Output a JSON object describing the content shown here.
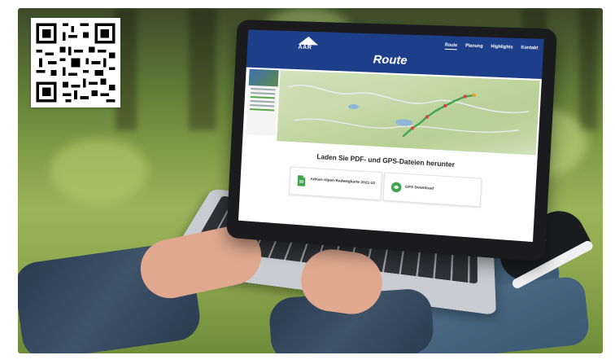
{
  "nav": {
    "items": [
      "Route",
      "Planung",
      "Highlights",
      "Kontakt"
    ],
    "active": "Route",
    "logo_text": "AAR"
  },
  "page": {
    "title": "Route",
    "downloads_heading": "Laden Sie PDF- und GPS-Dateien herunter"
  },
  "downloads": {
    "pdf_label": "Adrian-Alpen-Radwegkarte 2021-22",
    "gps_label": "GPS Download"
  },
  "icons": [
    "qr-code-icon",
    "pdf-file-icon",
    "gps-download-icon",
    "mountain-logo-icon"
  ],
  "colors": {
    "nav_background": "#1d3f8a",
    "route_line": "#3fa34d",
    "accent_green": "#5aa846"
  }
}
